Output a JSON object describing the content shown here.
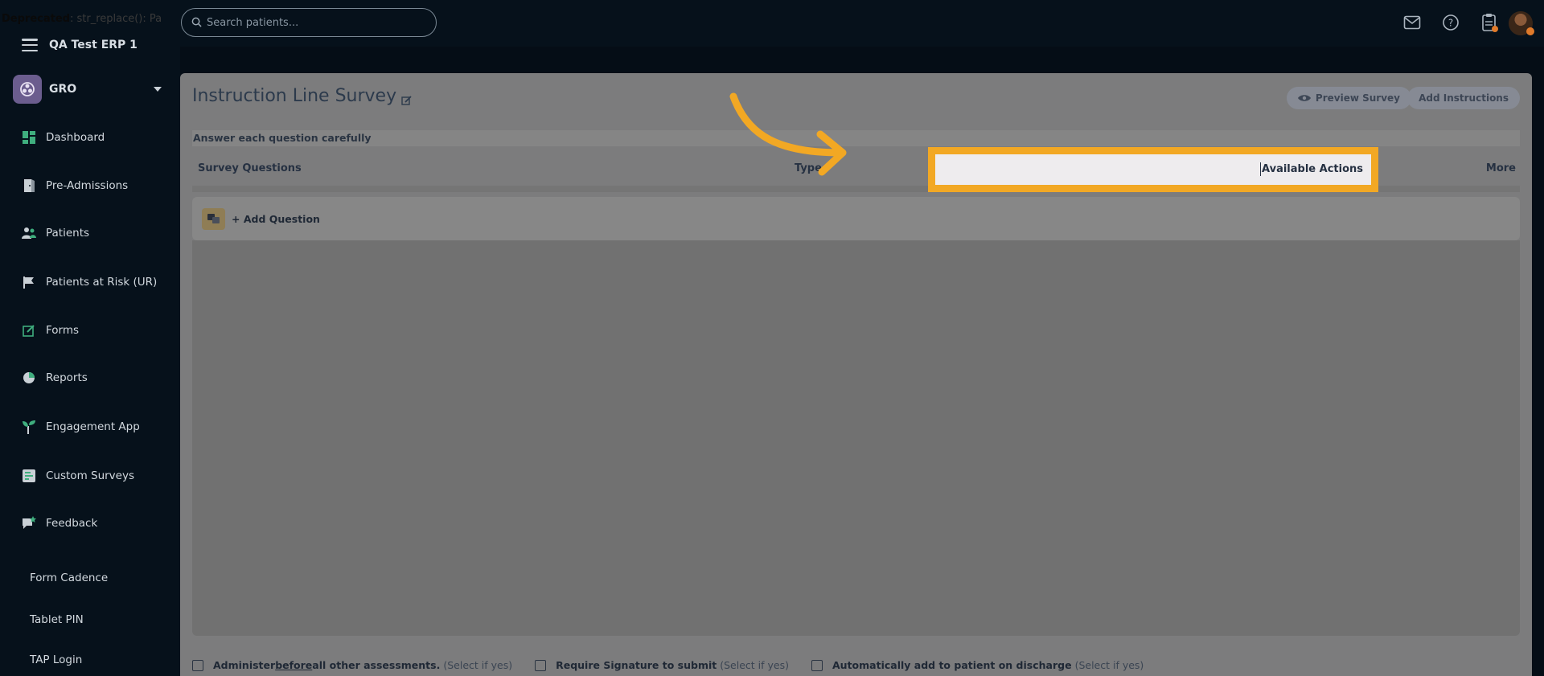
{
  "topbar": {
    "deprecated_notice_bold": "Deprecated",
    "deprecated_notice_rest": ": str_replace(): Pa",
    "search_placeholder": "Search patients...",
    "icons": [
      "mail-icon",
      "help-icon",
      "clipboard-icon",
      "avatar"
    ]
  },
  "sidebar": {
    "org_name": "QA Test ERP 1",
    "brand_name": "GRO",
    "items": [
      {
        "label": "Dashboard",
        "icon": "dashboard-icon"
      },
      {
        "label": "Pre-Admissions",
        "icon": "door-icon"
      },
      {
        "label": "Patients",
        "icon": "users-icon"
      },
      {
        "label": "Patients at Risk (UR)",
        "icon": "flag-icon"
      },
      {
        "label": "Forms",
        "icon": "edit-form-icon"
      },
      {
        "label": "Reports",
        "icon": "pie-chart-icon"
      },
      {
        "label": "Engagement App",
        "icon": "sprout-icon"
      },
      {
        "label": "Custom Surveys",
        "icon": "survey-icon"
      },
      {
        "label": "Feedback",
        "icon": "feedback-icon"
      }
    ],
    "sub_items": [
      "Form Cadence",
      "Tablet PIN",
      "TAP Login"
    ]
  },
  "main": {
    "title": "Instruction Line Survey",
    "preview_button": "Preview Survey",
    "add_instructions_button": "Add Instructions",
    "instructions_text": "Answer each question carefully",
    "table_headers": {
      "survey_questions": "Survey Questions",
      "type": "Type",
      "available_actions": "Available Actions",
      "more": "More"
    },
    "add_question_label": "+ Add Question",
    "options": [
      {
        "prefix": "Administer ",
        "underlined": "before",
        "suffix": " all other assessments.",
        "hint": "(Select if yes)"
      },
      {
        "prefix": "Require Signature to submit",
        "underlined": "",
        "suffix": "",
        "hint": "(Select if yes)"
      },
      {
        "prefix": "Automatically add to patient on discharge",
        "underlined": "",
        "suffix": "",
        "hint": "(Select if yes)"
      }
    ]
  },
  "colors": {
    "highlight": "#f2a824",
    "brand": "#6b5d8e",
    "sidebar_bg": "#06111b"
  }
}
